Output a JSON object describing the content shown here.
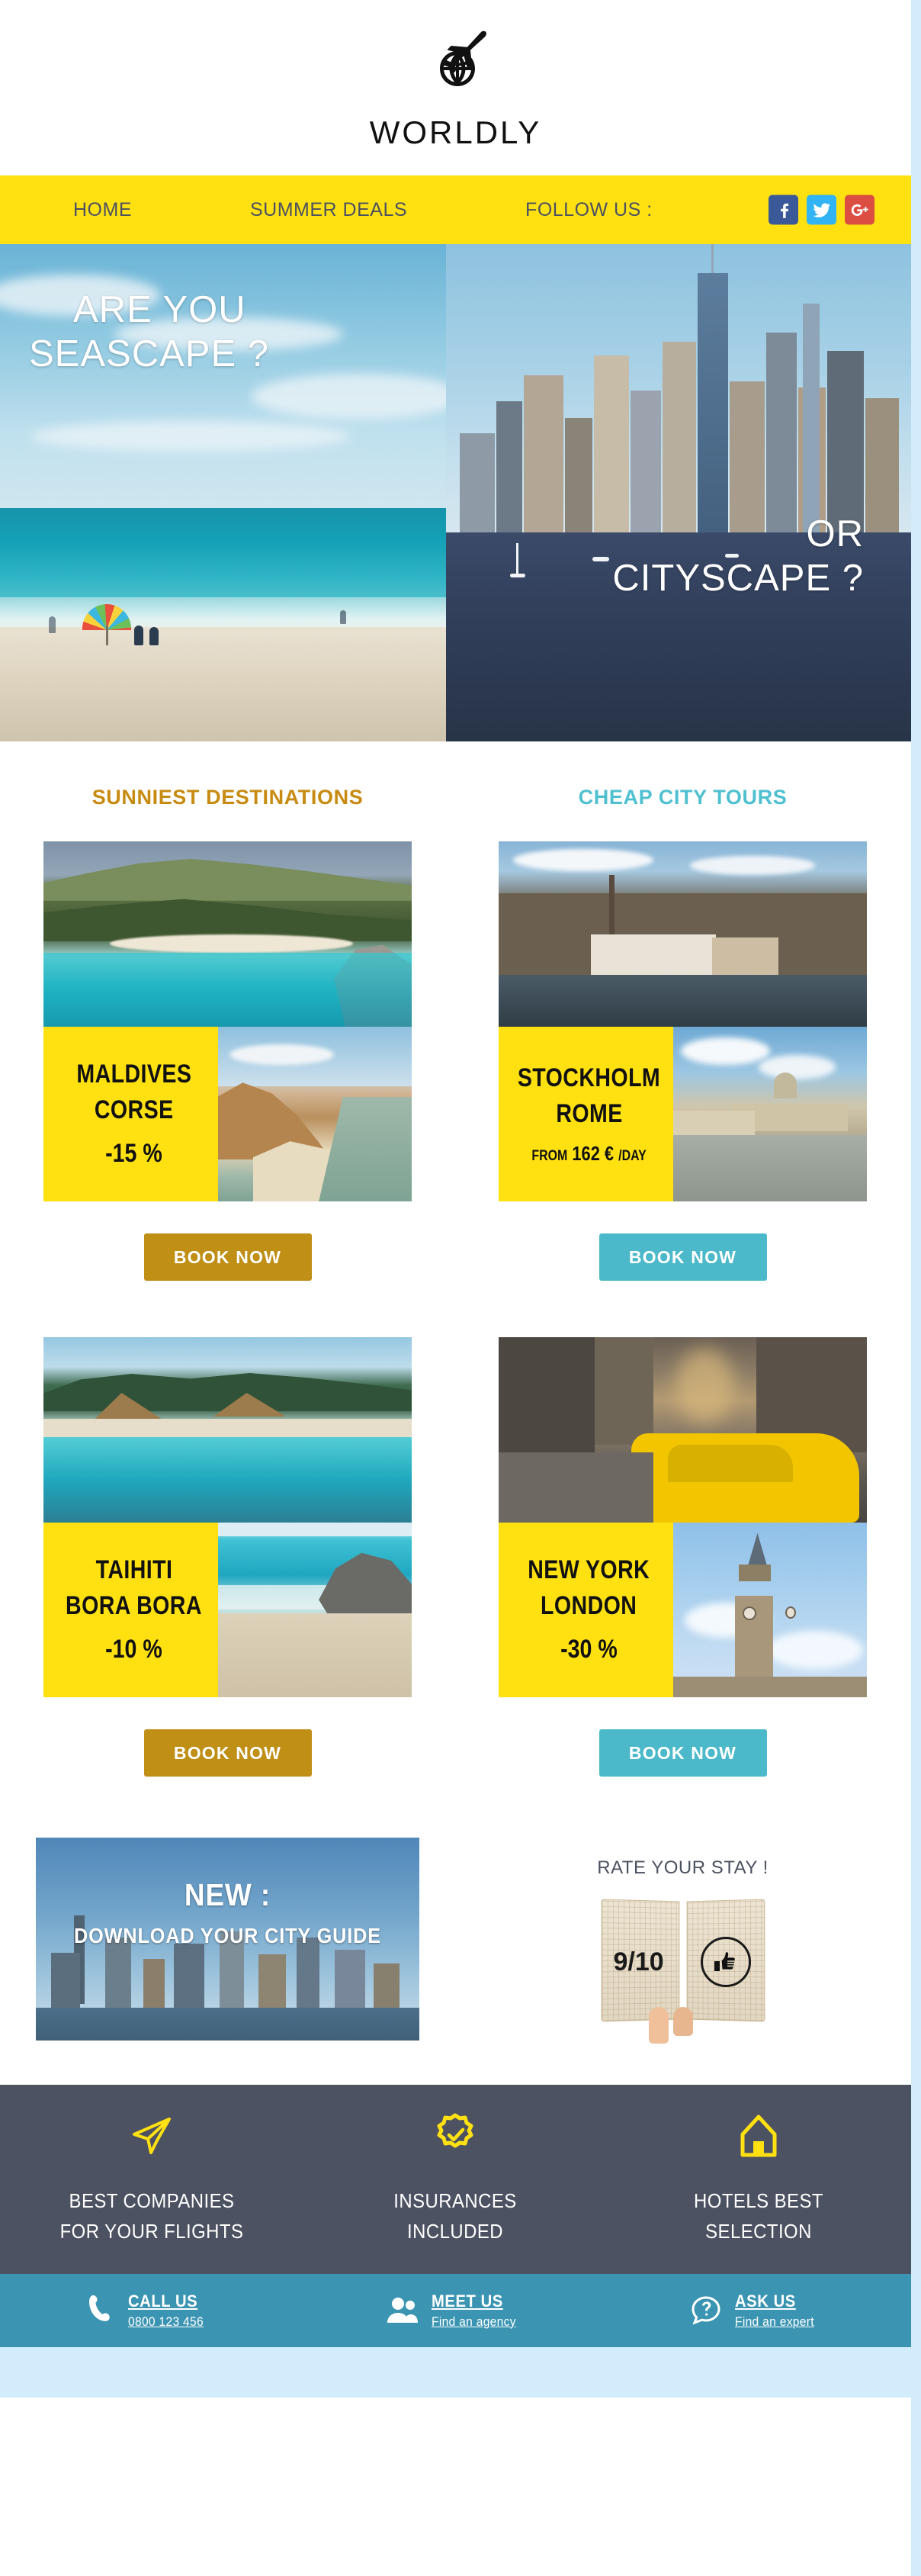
{
  "brand": {
    "name": "WORLDLY",
    "logo_icon": "globe-airplane-icon"
  },
  "nav": {
    "items": [
      {
        "label": "HOME",
        "name": "nav-home"
      },
      {
        "label": "SUMMER DEALS",
        "name": "nav-summer-deals"
      },
      {
        "label": "FOLLOW US :",
        "name": "nav-follow-us"
      }
    ],
    "social": [
      {
        "network": "facebook",
        "glyph": "f",
        "color": "#3b5998"
      },
      {
        "network": "twitter",
        "glyph": "bird",
        "color": "#31b3f4"
      },
      {
        "network": "google-plus",
        "glyph": "G+",
        "color": "#dc4e41"
      }
    ]
  },
  "hero": {
    "left": {
      "line1": "ARE YOU",
      "line2": "SEASCAPE ?"
    },
    "right": {
      "line1": "OR",
      "line2": "CITYSCAPE ?"
    }
  },
  "sections": {
    "left_heading": "SUNNIEST DESTINATIONS",
    "left_color": "#c88b12",
    "right_heading": "CHEAP CITY TOURS",
    "right_color": "#4fc0d0"
  },
  "deals": {
    "left": [
      {
        "title_line1": "MALDIVES",
        "title_line2": "CORSE",
        "offer": "-15 %",
        "cta": "BOOK NOW",
        "cta_color": "#bf8f16"
      },
      {
        "title_line1": "TAIHITI",
        "title_line2": "BORA BORA",
        "offer": "-10 %",
        "cta": "BOOK NOW",
        "cta_color": "#bf8f16"
      }
    ],
    "right": [
      {
        "title_line1": "STOCKHOLM",
        "title_line2": "ROME",
        "offer_prefix": "FROM",
        "offer": "162 €",
        "offer_suffix": "/DAY",
        "cta": "BOOK NOW",
        "cta_color": "#4bb9c9"
      },
      {
        "title_line1": "NEW YORK",
        "title_line2": "LONDON",
        "offer": "-30 %",
        "cta": "BOOK NOW",
        "cta_color": "#4bb9c9"
      }
    ]
  },
  "promo": {
    "guide_line1": "NEW :",
    "guide_line2": "DOWNLOAD YOUR CITY GUIDE",
    "rate_title": "RATE YOUR STAY !",
    "rate_score": "9/10",
    "rate_icon": "thumbs-up-icon"
  },
  "features": [
    {
      "icon": "paper-plane-icon",
      "line1": "BEST COMPANIES",
      "line2": "FOR YOUR FLIGHTS"
    },
    {
      "icon": "badge-check-icon",
      "line1": "INSURANCES",
      "line2": "INCLUDED"
    },
    {
      "icon": "home-icon",
      "line1": "HOTELS BEST",
      "line2": "SELECTION"
    }
  ],
  "contact": [
    {
      "icon": "phone-icon",
      "title": "CALL US",
      "sub": "0800 123 456"
    },
    {
      "icon": "people-icon",
      "title": "MEET US",
      "sub": "Find an agency"
    },
    {
      "icon": "question-bubble-icon",
      "title": "ASK US",
      "sub": "Find an expert"
    }
  ],
  "theme": {
    "yellow": "#ffe112",
    "slate": "#4c5261",
    "teal": "#3b95b2",
    "page_bg": "#d3ecfb"
  }
}
